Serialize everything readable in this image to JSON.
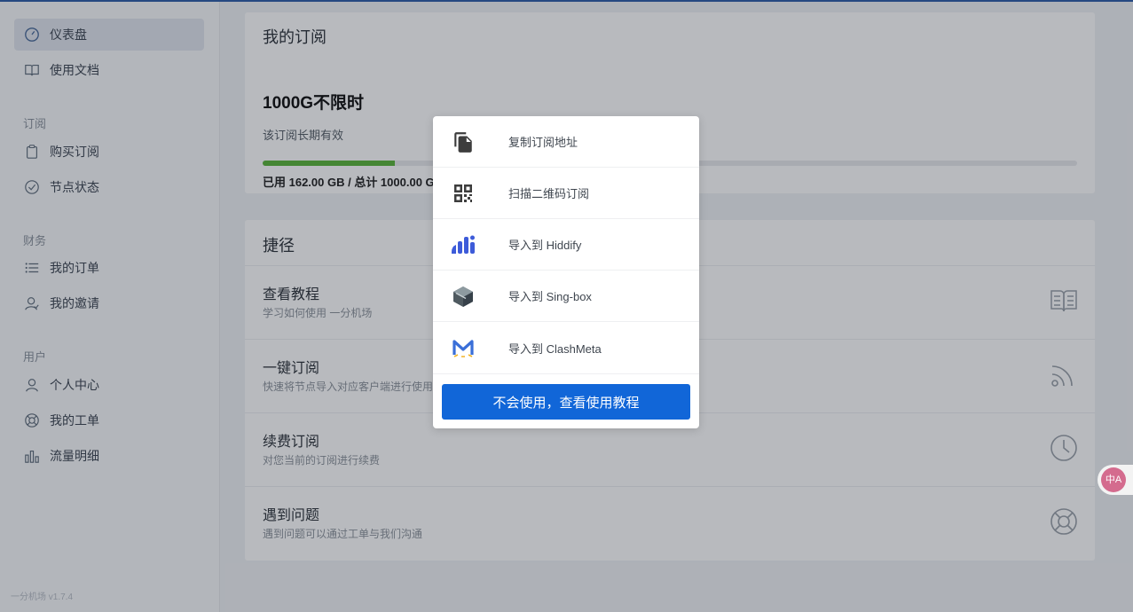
{
  "sidebar": {
    "items": [
      {
        "label": "仪表盘",
        "icon": "dashboard-icon"
      },
      {
        "label": "使用文档",
        "icon": "book-icon"
      },
      {
        "label": "购买订阅",
        "icon": "clipboard-icon"
      },
      {
        "label": "节点状态",
        "icon": "check-circle-icon"
      },
      {
        "label": "我的订单",
        "icon": "list-icon"
      },
      {
        "label": "我的邀请",
        "icon": "user-invite-icon"
      },
      {
        "label": "个人中心",
        "icon": "user-icon"
      },
      {
        "label": "我的工单",
        "icon": "support-icon"
      },
      {
        "label": "流量明细",
        "icon": "bar-chart-icon"
      }
    ],
    "groups": [
      "订阅",
      "财务",
      "用户"
    ],
    "version": "一分机场 v1.7.4"
  },
  "subscription": {
    "title": "我的订阅",
    "plan_name": "1000G不限时",
    "validity": "该订阅长期有效",
    "usage_text": "已用 162.00 GB / 总计 1000.00 GB",
    "usage_fraction": 0.162
  },
  "shortcuts": {
    "title": "捷径",
    "items": [
      {
        "title": "查看教程",
        "desc": "学习如何使用 一分机场",
        "icon": "book-icon"
      },
      {
        "title": "一键订阅",
        "desc": "快速将节点导入对应客户端进行使用",
        "icon": "rss-icon"
      },
      {
        "title": "续费订阅",
        "desc": "对您当前的订阅进行续费",
        "icon": "clock-icon"
      },
      {
        "title": "遇到问题",
        "desc": "遇到问题可以通过工单与我们沟通",
        "icon": "lifebuoy-icon"
      }
    ]
  },
  "popup": {
    "items": [
      {
        "label": "复制订阅地址",
        "icon": "copy-icon"
      },
      {
        "label": "扫描二维码订阅",
        "icon": "qr-code-icon"
      },
      {
        "label": "导入到 Hiddify",
        "icon": "hiddify-icon"
      },
      {
        "label": "导入到 Sing-box",
        "icon": "sing-box-icon"
      },
      {
        "label": "导入到 ClashMeta",
        "icon": "clashmeta-icon"
      }
    ],
    "help_button": "不会使用，查看使用教程"
  },
  "translate": {
    "label": "中A"
  },
  "colors": {
    "primary": "#1166d8",
    "progress": "#5bb53a",
    "hiddify": "#3d5bd9",
    "clashmeta": "#3a6fd8"
  }
}
